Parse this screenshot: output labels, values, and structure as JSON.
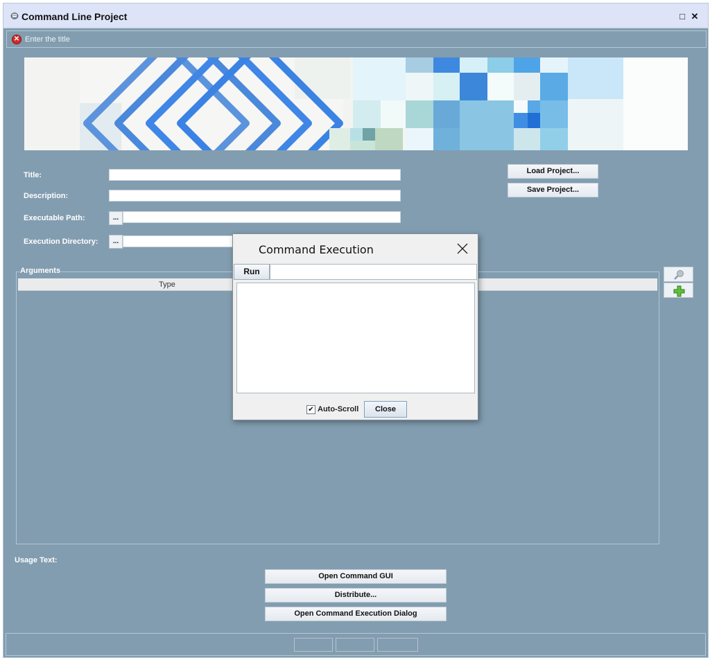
{
  "window": {
    "title": "Command Line Project",
    "maximize_glyph": "□",
    "close_glyph": "✕",
    "icon": "app-icon"
  },
  "message": {
    "text": "Enter the title",
    "icon": "error-icon"
  },
  "form": {
    "title_label": "Title:",
    "description_label": "Description:",
    "exe_path_label": "Executable Path:",
    "exec_dir_label": "Execution Directory:",
    "browse_label": "...",
    "title_value": "",
    "description_value": "",
    "exe_path_value": "",
    "exec_dir_value": ""
  },
  "project": {
    "load_label": "Load Project...",
    "save_label": "Save Project..."
  },
  "arguments": {
    "legend": "Arguments",
    "columns": [
      "Type"
    ]
  },
  "usage": {
    "label": "Usage Text:"
  },
  "actions": {
    "open_gui": "Open Command GUI",
    "distribute": "Distribute...",
    "open_exec_dialog": "Open Command Execution Dialog"
  },
  "dialog": {
    "title": "Command Execution",
    "run_label": "Run",
    "command_value": "",
    "auto_scroll_label": "Auto-Scroll",
    "auto_scroll_checked": true,
    "close_label": "Close"
  },
  "colors": {
    "background": "#829db0",
    "titlebar": "#dde4f7",
    "accent_blue": "#3f86e6"
  }
}
